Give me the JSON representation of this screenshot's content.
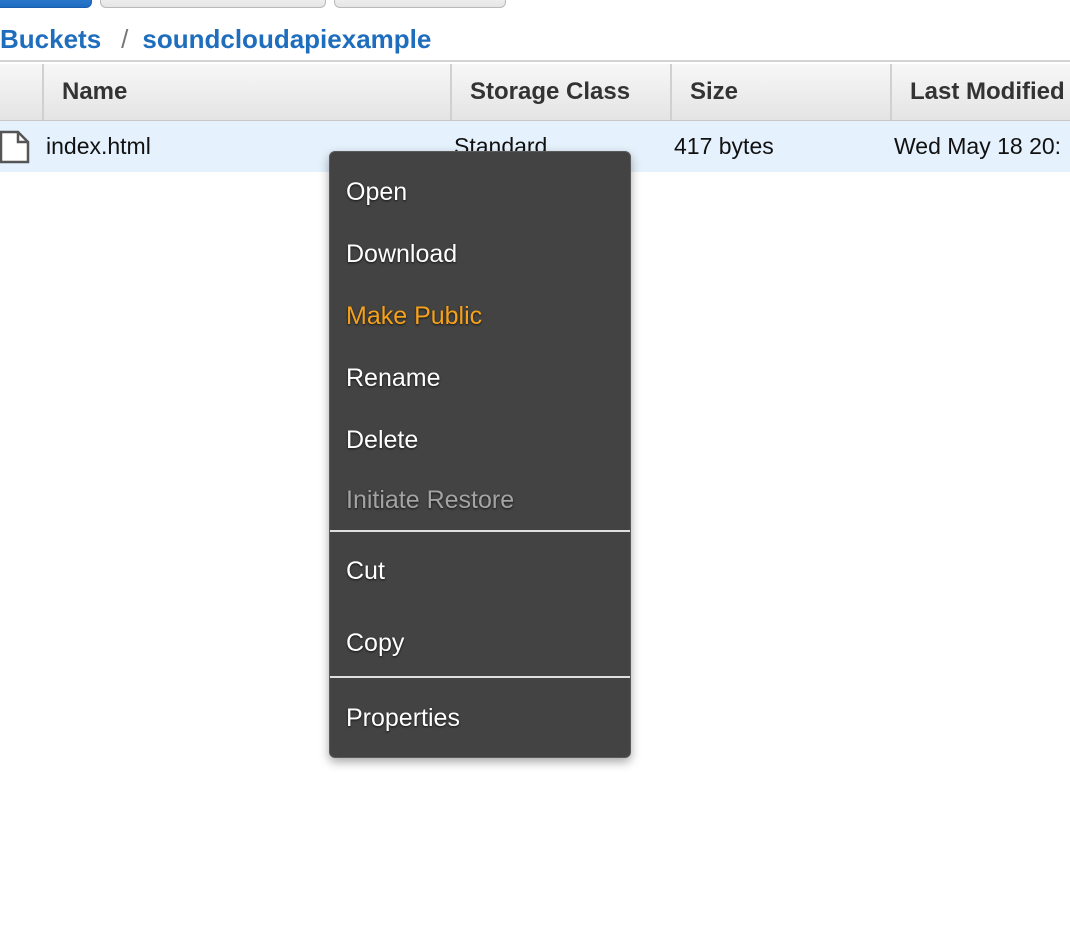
{
  "breadcrumb": {
    "root": "Buckets",
    "separator": "/",
    "current": "soundcloudapiexample"
  },
  "table": {
    "columns": [
      "Name",
      "Storage Class",
      "Size",
      "Last Modified"
    ],
    "rows": [
      {
        "icon": "file-icon",
        "name": "index.html",
        "storage_class": "Standard",
        "size": "417 bytes",
        "last_modified": "Wed May 18 20:"
      }
    ]
  },
  "context_menu": {
    "items": [
      {
        "label": "Open",
        "state": "normal"
      },
      {
        "label": "Download",
        "state": "normal"
      },
      {
        "label": "Make Public",
        "state": "highlighted"
      },
      {
        "label": "Rename",
        "state": "normal"
      },
      {
        "label": "Delete",
        "state": "normal"
      },
      {
        "label": "Initiate Restore",
        "state": "disabled"
      },
      {
        "label": "Cut",
        "state": "normal"
      },
      {
        "label": "Copy",
        "state": "normal"
      },
      {
        "label": "Properties",
        "state": "normal"
      }
    ]
  },
  "colors": {
    "link": "#1f6ebd",
    "row_selected": "#e5f1fc",
    "menu_background": "#434343",
    "menu_highlight": "#f5a21a",
    "menu_disabled": "#a3a3a3"
  }
}
